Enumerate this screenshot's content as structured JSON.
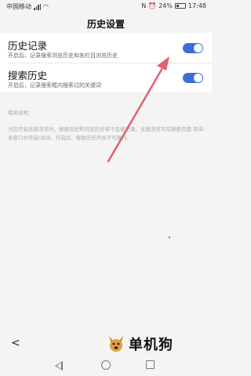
{
  "status_bar": {
    "carrier": "中国移动",
    "battery_pct": "24%",
    "time": "17:48"
  },
  "header": {
    "title": "历史设置"
  },
  "settings": [
    {
      "title": "历史记录",
      "desc": "开启后，记录搜索浏览历史和各栏目浏览历史",
      "enabled": true
    },
    {
      "title": "搜索历史",
      "desc": "开启后，记录搜索框内搜索过的关键词",
      "enabled": true
    }
  ],
  "notes": {
    "title": "相关说明：",
    "body": "当您开启无痕浏览时，搜索历史和浏览历史将不会被记录。无痕浏览可在搜索页面-菜单-多窗口中开启/关闭，开启后，搜索历史开关不可操作。"
  },
  "footer": {
    "back": "<",
    "brand": "单机狗"
  },
  "colors": {
    "toggle_on": "#3b6fd8",
    "arrow": "#e06070"
  }
}
